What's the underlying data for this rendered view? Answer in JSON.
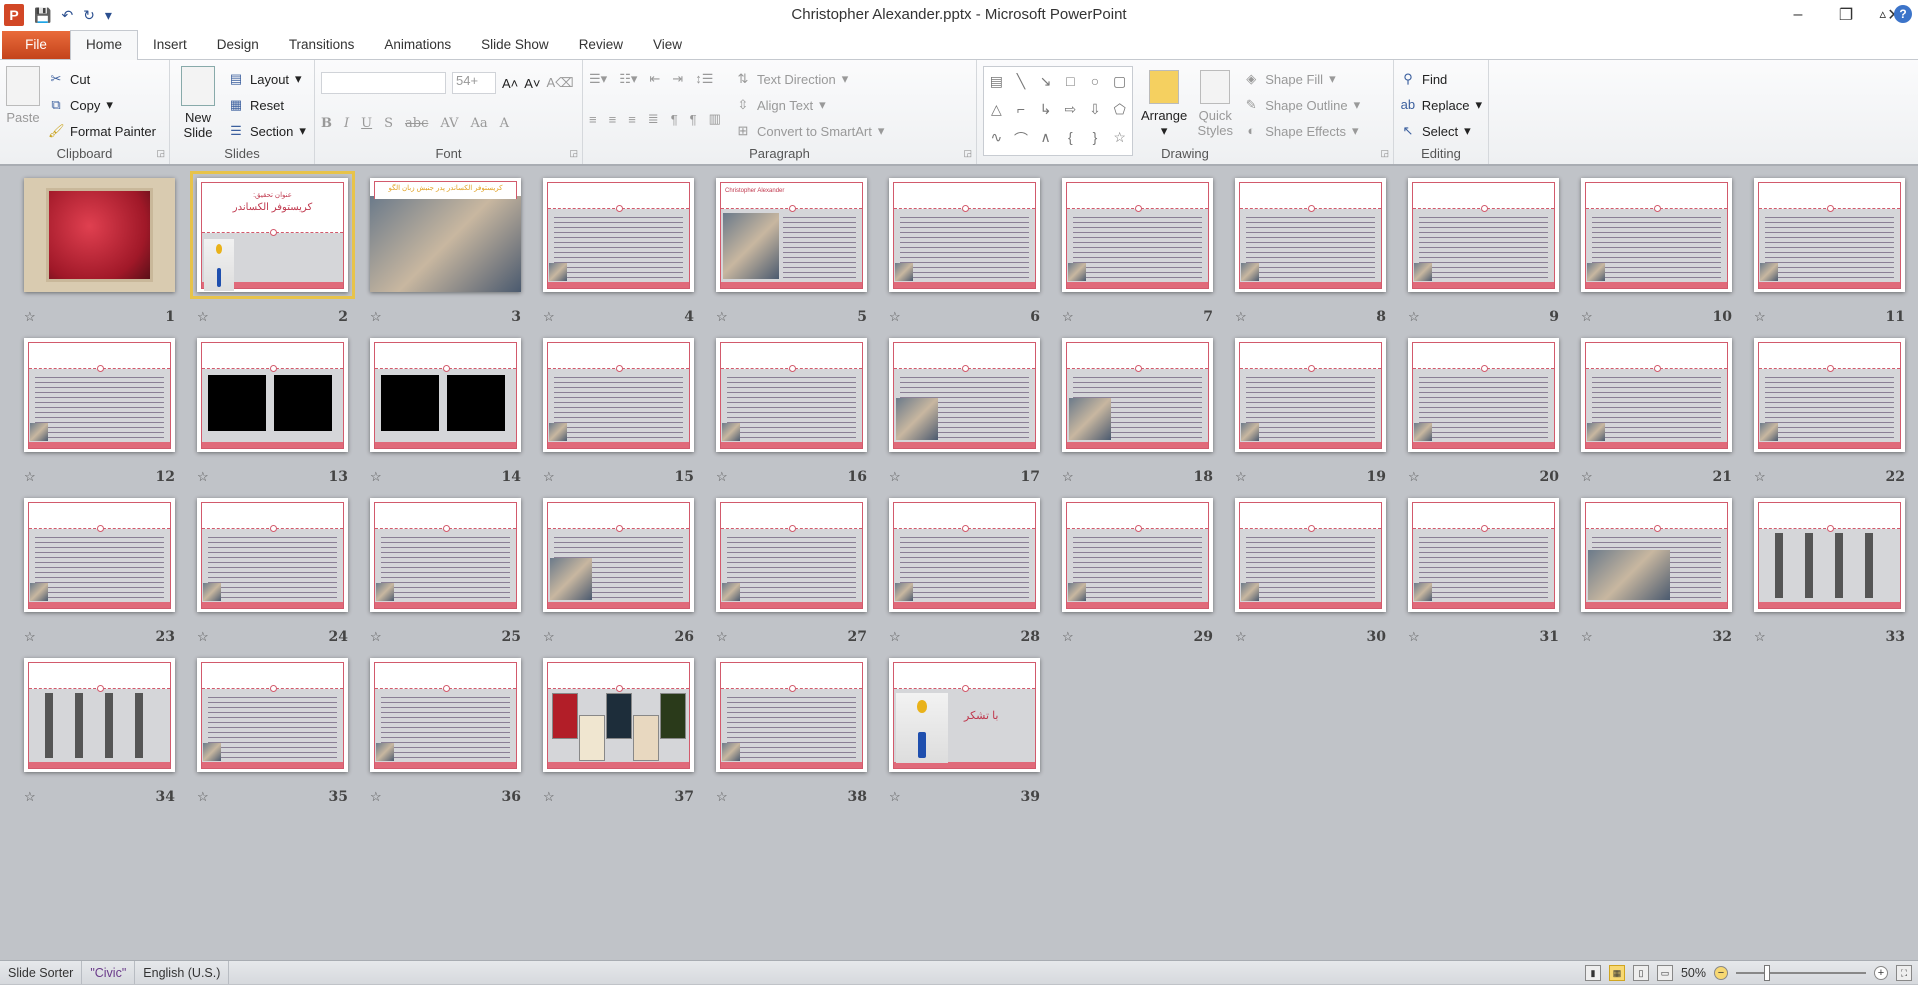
{
  "window": {
    "title": "Christopher Alexander.pptx - Microsoft PowerPoint",
    "minimize": "–",
    "restore": "❐",
    "close": "✕"
  },
  "qat": {
    "app_icon": "P",
    "save": "💾",
    "undo": "↶",
    "redo": "↻",
    "customize": "▾"
  },
  "tabs": [
    "File",
    "Home",
    "Insert",
    "Design",
    "Transitions",
    "Animations",
    "Slide Show",
    "Review",
    "View"
  ],
  "active_tab": "Home",
  "help": {
    "collapse": "▵",
    "help": "?"
  },
  "ribbon": {
    "clipboard": {
      "label": "Clipboard",
      "paste": "Paste",
      "cut": "Cut",
      "copy": "Copy",
      "format_painter": "Format Painter"
    },
    "slides": {
      "label": "Slides",
      "new_slide": "New Slide",
      "layout": "Layout",
      "reset": "Reset",
      "section": "Section"
    },
    "font": {
      "label": "Font",
      "font_name": "",
      "font_size": "54+",
      "bold": "B",
      "italic": "I",
      "underline": "U",
      "shadow": "S",
      "strike": "abc",
      "spacing": "AV",
      "case": "Aa",
      "color": "A",
      "grow": "A˄",
      "shrink": "A˅",
      "clear": "A⌫"
    },
    "paragraph": {
      "label": "Paragraph",
      "text_direction": "Text Direction",
      "align_text": "Align Text",
      "convert_smartart": "Convert to SmartArt"
    },
    "drawing": {
      "label": "Drawing",
      "arrange": "Arrange",
      "quick_styles": "Quick Styles",
      "shape_fill": "Shape Fill",
      "shape_outline": "Shape Outline",
      "shape_effects": "Shape Effects",
      "shapes": [
        "▤",
        "╲",
        "↘",
        "□",
        "○",
        "▢",
        "△",
        "⌐",
        "↳",
        "⇨",
        "⇩",
        "⬠",
        "∿",
        "⌒",
        "∧",
        "{",
        "}",
        "☆"
      ]
    },
    "editing": {
      "label": "Editing",
      "find": "Find",
      "replace": "Replace",
      "select": "Select"
    }
  },
  "slides": [
    {
      "n": "1",
      "layout": "art"
    },
    {
      "n": "2",
      "layout": "title",
      "subtitle": "عنوان تحقیق:",
      "title": "کریستوفر الکساندر",
      "selected": true
    },
    {
      "n": "3",
      "layout": "photo",
      "title": "کریستوفر الکساندر پدر جنبش زبان الگو"
    },
    {
      "n": "4",
      "layout": "text-smallpic"
    },
    {
      "n": "5",
      "layout": "bio",
      "title": "Christopher Alexander"
    },
    {
      "n": "6",
      "layout": "text-smallpic"
    },
    {
      "n": "7",
      "layout": "text-smallpic"
    },
    {
      "n": "8",
      "layout": "text-smallpic"
    },
    {
      "n": "9",
      "layout": "text-smallpic"
    },
    {
      "n": "10",
      "layout": "text-smallpic"
    },
    {
      "n": "11",
      "layout": "text-smallpic"
    },
    {
      "n": "12",
      "layout": "text-smallpic"
    },
    {
      "n": "13",
      "layout": "diagram"
    },
    {
      "n": "14",
      "layout": "diagram"
    },
    {
      "n": "15",
      "layout": "text-smallpic"
    },
    {
      "n": "16",
      "layout": "text-smallpic"
    },
    {
      "n": "17",
      "layout": "text-medpic"
    },
    {
      "n": "18",
      "layout": "text-medpic"
    },
    {
      "n": "19",
      "layout": "text-smallpic"
    },
    {
      "n": "20",
      "layout": "text-smallpic"
    },
    {
      "n": "21",
      "layout": "text-smallpic"
    },
    {
      "n": "22",
      "layout": "text-smallpic"
    },
    {
      "n": "23",
      "layout": "text-smallpic"
    },
    {
      "n": "24",
      "layout": "text-smallpic"
    },
    {
      "n": "25",
      "layout": "text-smallpic"
    },
    {
      "n": "26",
      "layout": "text-medpic"
    },
    {
      "n": "27",
      "layout": "text-smallpic"
    },
    {
      "n": "28",
      "layout": "text-smallpic"
    },
    {
      "n": "29",
      "layout": "text-smallpic"
    },
    {
      "n": "30",
      "layout": "text-smallpic"
    },
    {
      "n": "31",
      "layout": "text-smallpic"
    },
    {
      "n": "32",
      "layout": "text-bigpic"
    },
    {
      "n": "33",
      "layout": "patterns"
    },
    {
      "n": "34",
      "layout": "patterns"
    },
    {
      "n": "35",
      "layout": "text-smallpic"
    },
    {
      "n": "36",
      "layout": "text-smallpic"
    },
    {
      "n": "37",
      "layout": "books"
    },
    {
      "n": "38",
      "layout": "text-smallpic"
    },
    {
      "n": "39",
      "layout": "thanks",
      "title": "با تشکر"
    }
  ],
  "status": {
    "view": "Slide Sorter",
    "theme": "\"Civic\"",
    "language": "English (U.S.)",
    "zoom": "50%",
    "zoom_percent": 50
  },
  "colors": {
    "accent": "#d25a6c",
    "file_tab": "#d24726",
    "selection": "#e7c34a"
  }
}
